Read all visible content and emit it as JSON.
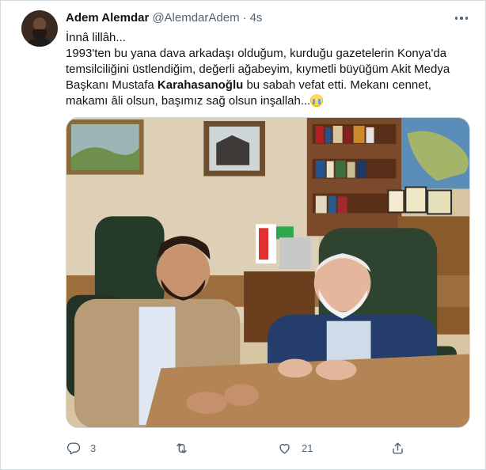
{
  "author": {
    "name": "Adem Alemdar",
    "handle": "@AlemdarAdem",
    "separator": "·",
    "time": "4s"
  },
  "tweet": {
    "line1": "İnnâ lillâh...",
    "body_before_bold": "1993'ten bu yana dava arkadaşı olduğum, kurduğu gazetelerin Konya'da temsilciliğini üstlendiğim, değerli ağabeyim, kıymetli büyüğüm Akit Medya Başkanı Mustafa ",
    "body_bold": "Karahasanoğlu",
    "body_after_bold": " bu sabah vefat etti. Mekanı cennet, makamı âli olsun, başımız sağ olsun inşallah...",
    "emoji": "loudly-crying-face-emoji"
  },
  "media": {
    "description_icon": "photo-two-men-at-desk"
  },
  "actions": {
    "reply_count": "3",
    "retweet_count": "",
    "like_count": "21",
    "icons": [
      "reply-icon",
      "retweet-icon",
      "like-icon",
      "share-icon"
    ]
  },
  "colors": {
    "text": "#0f1419",
    "secondary": "#536471",
    "border": "#cfd9de"
  }
}
